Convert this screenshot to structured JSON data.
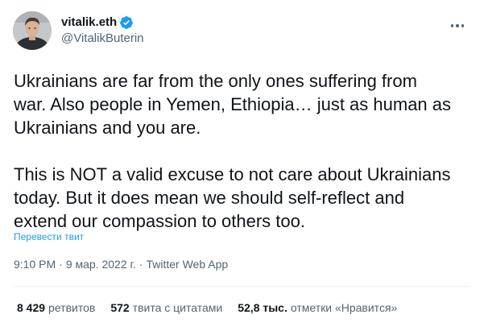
{
  "author": {
    "display_name": "vitalik.eth",
    "handle": "@VitalikButerin",
    "verified": true,
    "verified_color": "#1d9bf0"
  },
  "more_icon": "more-horizontal-icon",
  "tweet": {
    "paragraphs": [
      "Ukrainians are far from the only ones suffering from\nwar. Also people in Yemen, Ethiopia… just as human as\nUkrainians and you are.",
      "This is NOT a valid excuse to not care about Ukrainians\ntoday. But it does mean we should self-reflect and\nextend our compassion to others too."
    ],
    "translate_label": "Перевести твит"
  },
  "meta": {
    "time": "9:10 PM",
    "date": "9 мар. 2022 г.",
    "source": "Twitter Web App"
  },
  "stats": [
    {
      "count": "8 429",
      "label": "ретвитов"
    },
    {
      "count": "572",
      "label": "твита с цитатами"
    },
    {
      "count": "52,8 тыс.",
      "label": "отметки «Нравится»"
    }
  ],
  "colors": {
    "link": "#1d9bf0",
    "secondary_text": "#536471",
    "primary_text": "#0f1419",
    "divider": "#eff3f4"
  }
}
